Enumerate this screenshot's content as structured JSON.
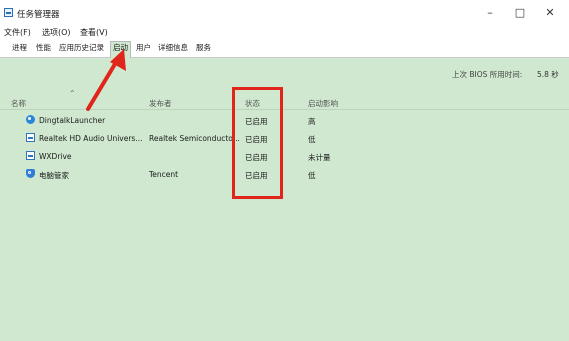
{
  "window": {
    "title": "任务管理器"
  },
  "menu": [
    "文件(F)",
    "选项(O)",
    "查看(V)"
  ],
  "tabs": [
    "进程",
    "性能",
    "应用历史记录",
    "启动",
    "用户",
    "详细信息",
    "服务"
  ],
  "active_tab_index": 3,
  "bios": {
    "label": "上次 BIOS 所用时间:",
    "value": "5.8 秒"
  },
  "columns": {
    "name": "名称",
    "publisher": "发布者",
    "status": "状态",
    "impact": "启动影响"
  },
  "rows": [
    {
      "icon": "dingtalk-icon",
      "name": "DingtalkLauncher",
      "publisher": "",
      "status": "已启用",
      "impact": "高"
    },
    {
      "icon": "app-icon",
      "name": "Realtek HD Audio Univers...",
      "publisher": "Realtek Semiconducto...",
      "status": "已启用",
      "impact": "低"
    },
    {
      "icon": "app-icon",
      "name": "WXDrive",
      "publisher": "",
      "status": "已启用",
      "impact": "未计量"
    },
    {
      "icon": "shield-icon",
      "name": "电脑管家",
      "publisher": "Tencent",
      "status": "已启用",
      "impact": "低"
    }
  ],
  "annotation_color": "#e0251b"
}
